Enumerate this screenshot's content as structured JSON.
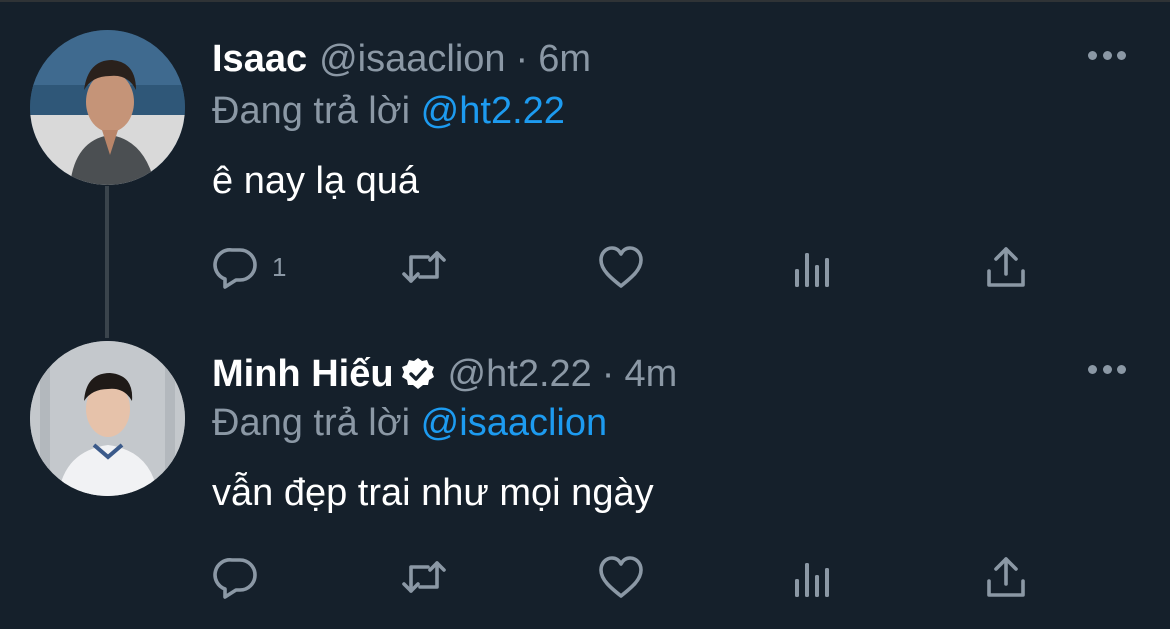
{
  "colors": {
    "background": "#15202b",
    "text": "#ffffff",
    "muted": "#8b98a5",
    "accent": "#1d9bf0",
    "thread_line": "#3a444c"
  },
  "tweets": [
    {
      "name": "Isaac",
      "handle": "@isaaclion",
      "separator": "·",
      "time": "6m",
      "verified": false,
      "replying_label": "Đang trả lời",
      "replying_to": "@ht2.22",
      "text": "ê nay lạ quá",
      "reply_count": "1",
      "icons": [
        "reply-icon",
        "retweet-icon",
        "like-icon",
        "analytics-icon",
        "share-icon",
        "more-icon"
      ]
    },
    {
      "name": "Minh Hiếu",
      "handle": "@ht2.22",
      "separator": "·",
      "time": "4m",
      "verified": true,
      "replying_label": "Đang trả lời",
      "replying_to": "@isaaclion",
      "text": "vẫn đẹp trai như mọi ngày",
      "reply_count": "",
      "icons": [
        "reply-icon",
        "retweet-icon",
        "like-icon",
        "analytics-icon",
        "share-icon",
        "more-icon"
      ]
    }
  ]
}
